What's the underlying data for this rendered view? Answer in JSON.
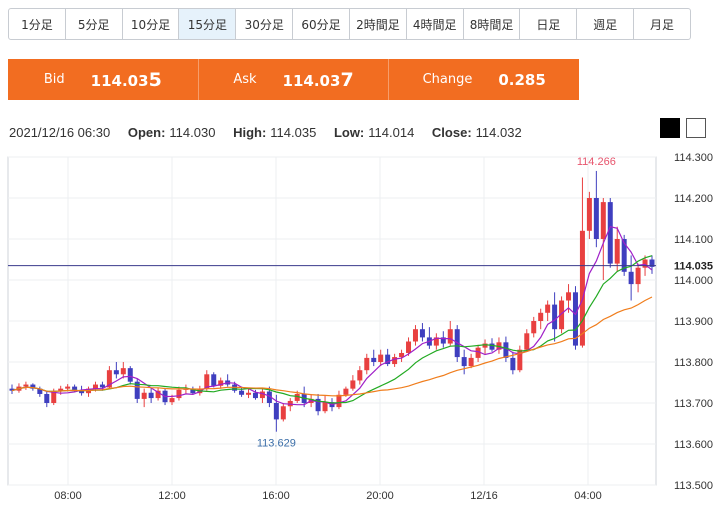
{
  "tabs": [
    "1分足",
    "5分足",
    "10分足",
    "15分足",
    "30分足",
    "60分足",
    "2時間足",
    "4時間足",
    "8時間足",
    "日足",
    "週足",
    "月足"
  ],
  "active_tab": "15分足",
  "quote": {
    "bid_label": "Bid",
    "bid_main": "114.03",
    "bid_last": "5",
    "ask_label": "Ask",
    "ask_main": "114.03",
    "ask_last": "7",
    "change_label": "Change",
    "change_value": "0.285",
    "color": "#f26d21"
  },
  "ohlc": {
    "datetime": "2021/12/16 06:30",
    "open_label": "Open:",
    "open": "114.030",
    "high_label": "High:",
    "high": "114.035",
    "low_label": "Low:",
    "low": "114.014",
    "close_label": "Close:",
    "close": "114.032"
  },
  "chart_data": {
    "type": "candlestick",
    "y_ticks": [
      "114.300",
      "114.200",
      "114.100",
      "114.000",
      "113.900",
      "113.800",
      "113.700",
      "113.600",
      "113.500"
    ],
    "ylim": [
      113.5,
      114.3
    ],
    "x_ticks": [
      "08:00",
      "12:00",
      "16:00",
      "20:00",
      "12/16",
      "04:00"
    ],
    "current_price": "114.035",
    "max_label": "114.266",
    "min_label": "113.629",
    "colors": {
      "up": "#e84040",
      "down": "#3f3fbf",
      "ma_short": "#a020c8",
      "ma_mid": "#22aa22",
      "ma_long": "#f07d1c",
      "price_line": "#3a3a8c",
      "max": "#e8556d",
      "min": "#3b6ea8"
    },
    "candles": [
      [
        113.735,
        113.745,
        113.722,
        113.73
      ],
      [
        113.73,
        113.748,
        113.725,
        113.74
      ],
      [
        113.74,
        113.752,
        113.732,
        113.745
      ],
      [
        113.745,
        113.748,
        113.73,
        113.735
      ],
      [
        113.735,
        113.74,
        113.715,
        113.722
      ],
      [
        113.722,
        113.73,
        113.69,
        113.7
      ],
      [
        113.7,
        113.735,
        113.695,
        113.728
      ],
      [
        113.728,
        113.742,
        113.72,
        113.735
      ],
      [
        113.735,
        113.746,
        113.728,
        113.74
      ],
      [
        113.74,
        113.745,
        113.728,
        113.732
      ],
      [
        113.732,
        113.742,
        113.718,
        113.724
      ],
      [
        113.724,
        113.74,
        113.715,
        113.735
      ],
      [
        113.735,
        113.752,
        113.728,
        113.745
      ],
      [
        113.745,
        113.752,
        113.73,
        113.738
      ],
      [
        113.738,
        113.79,
        113.734,
        113.78
      ],
      [
        113.78,
        113.8,
        113.76,
        113.77
      ],
      [
        113.77,
        113.8,
        113.76,
        113.785
      ],
      [
        113.785,
        113.79,
        113.745,
        113.752
      ],
      [
        113.752,
        113.76,
        113.7,
        113.71
      ],
      [
        113.71,
        113.735,
        113.69,
        113.725
      ],
      [
        113.725,
        113.738,
        113.7,
        113.712
      ],
      [
        113.712,
        113.738,
        113.706,
        113.73
      ],
      [
        113.73,
        113.736,
        113.695,
        113.702
      ],
      [
        113.702,
        113.72,
        113.695,
        113.712
      ],
      [
        113.712,
        113.74,
        113.706,
        113.732
      ],
      [
        113.732,
        113.745,
        113.722,
        113.735
      ],
      [
        113.735,
        113.74,
        113.72,
        113.724
      ],
      [
        113.724,
        113.742,
        113.718,
        113.735
      ],
      [
        113.735,
        113.78,
        113.73,
        113.77
      ],
      [
        113.77,
        113.775,
        113.738,
        113.742
      ],
      [
        113.742,
        113.762,
        113.735,
        113.755
      ],
      [
        113.755,
        113.77,
        113.74,
        113.745
      ],
      [
        113.745,
        113.752,
        113.725,
        113.73
      ],
      [
        113.73,
        113.74,
        113.715,
        113.72
      ],
      [
        113.72,
        113.735,
        113.712,
        113.725
      ],
      [
        113.725,
        113.732,
        113.708,
        113.712
      ],
      [
        113.712,
        113.735,
        113.7,
        113.728
      ],
      [
        113.728,
        113.74,
        113.69,
        113.7
      ],
      [
        113.7,
        113.72,
        113.63,
        113.66
      ],
      [
        113.66,
        113.7,
        113.655,
        113.692
      ],
      [
        113.692,
        113.712,
        113.68,
        113.705
      ],
      [
        113.705,
        113.73,
        113.7,
        113.722
      ],
      [
        113.722,
        113.74,
        113.69,
        113.7
      ],
      [
        113.7,
        113.722,
        113.69,
        113.71
      ],
      [
        113.71,
        113.722,
        113.67,
        113.68
      ],
      [
        113.68,
        113.718,
        113.675,
        113.702
      ],
      [
        113.702,
        113.712,
        113.68,
        113.69
      ],
      [
        113.69,
        113.73,
        113.685,
        113.72
      ],
      [
        113.72,
        113.74,
        113.715,
        113.735
      ],
      [
        113.735,
        113.768,
        113.73,
        113.755
      ],
      [
        113.755,
        113.79,
        113.745,
        113.78
      ],
      [
        113.78,
        113.82,
        113.77,
        113.81
      ],
      [
        113.81,
        113.83,
        113.79,
        113.8
      ],
      [
        113.8,
        113.83,
        113.79,
        113.818
      ],
      [
        113.818,
        113.832,
        113.79,
        113.795
      ],
      [
        113.795,
        113.82,
        113.788,
        113.812
      ],
      [
        113.812,
        113.83,
        113.8,
        113.822
      ],
      [
        113.822,
        113.86,
        113.815,
        113.85
      ],
      [
        113.85,
        113.89,
        113.84,
        113.88
      ],
      [
        113.88,
        113.895,
        113.85,
        113.86
      ],
      [
        113.86,
        113.885,
        113.832,
        113.84
      ],
      [
        113.84,
        113.87,
        113.83,
        113.86
      ],
      [
        113.86,
        113.875,
        113.835,
        113.845
      ],
      [
        113.845,
        113.9,
        113.84,
        113.88
      ],
      [
        113.88,
        113.89,
        113.8,
        113.812
      ],
      [
        113.812,
        113.83,
        113.77,
        113.79
      ],
      [
        113.79,
        113.82,
        113.785,
        113.81
      ],
      [
        113.81,
        113.842,
        113.8,
        113.835
      ],
      [
        113.835,
        113.855,
        113.82,
        113.845
      ],
      [
        113.845,
        113.858,
        113.825,
        113.83
      ],
      [
        113.83,
        113.86,
        113.82,
        113.848
      ],
      [
        113.848,
        113.862,
        113.8,
        113.81
      ],
      [
        113.81,
        113.825,
        113.77,
        113.78
      ],
      [
        113.78,
        113.84,
        113.775,
        113.83
      ],
      [
        113.83,
        113.88,
        113.825,
        113.87
      ],
      [
        113.87,
        113.91,
        113.86,
        113.9
      ],
      [
        113.9,
        113.93,
        113.88,
        113.92
      ],
      [
        113.92,
        113.95,
        113.9,
        113.94
      ],
      [
        113.94,
        113.97,
        113.85,
        113.88
      ],
      [
        113.88,
        113.96,
        113.87,
        113.95
      ],
      [
        113.95,
        113.99,
        113.92,
        113.97
      ],
      [
        113.97,
        113.985,
        113.83,
        113.84
      ],
      [
        113.84,
        114.25,
        113.835,
        114.12
      ],
      [
        114.12,
        114.215,
        114.1,
        114.2
      ],
      [
        114.2,
        114.266,
        114.08,
        114.1
      ],
      [
        114.1,
        114.2,
        114.0,
        114.19
      ],
      [
        114.19,
        114.2,
        114.03,
        114.04
      ],
      [
        114.04,
        114.13,
        114.02,
        114.1
      ],
      [
        114.1,
        114.11,
        114.01,
        114.02
      ],
      [
        114.02,
        114.06,
        113.95,
        113.99
      ],
      [
        113.99,
        114.04,
        113.97,
        114.03
      ],
      [
        114.03,
        114.06,
        114.01,
        114.05
      ],
      [
        114.05,
        114.06,
        114.015,
        114.032
      ]
    ]
  }
}
